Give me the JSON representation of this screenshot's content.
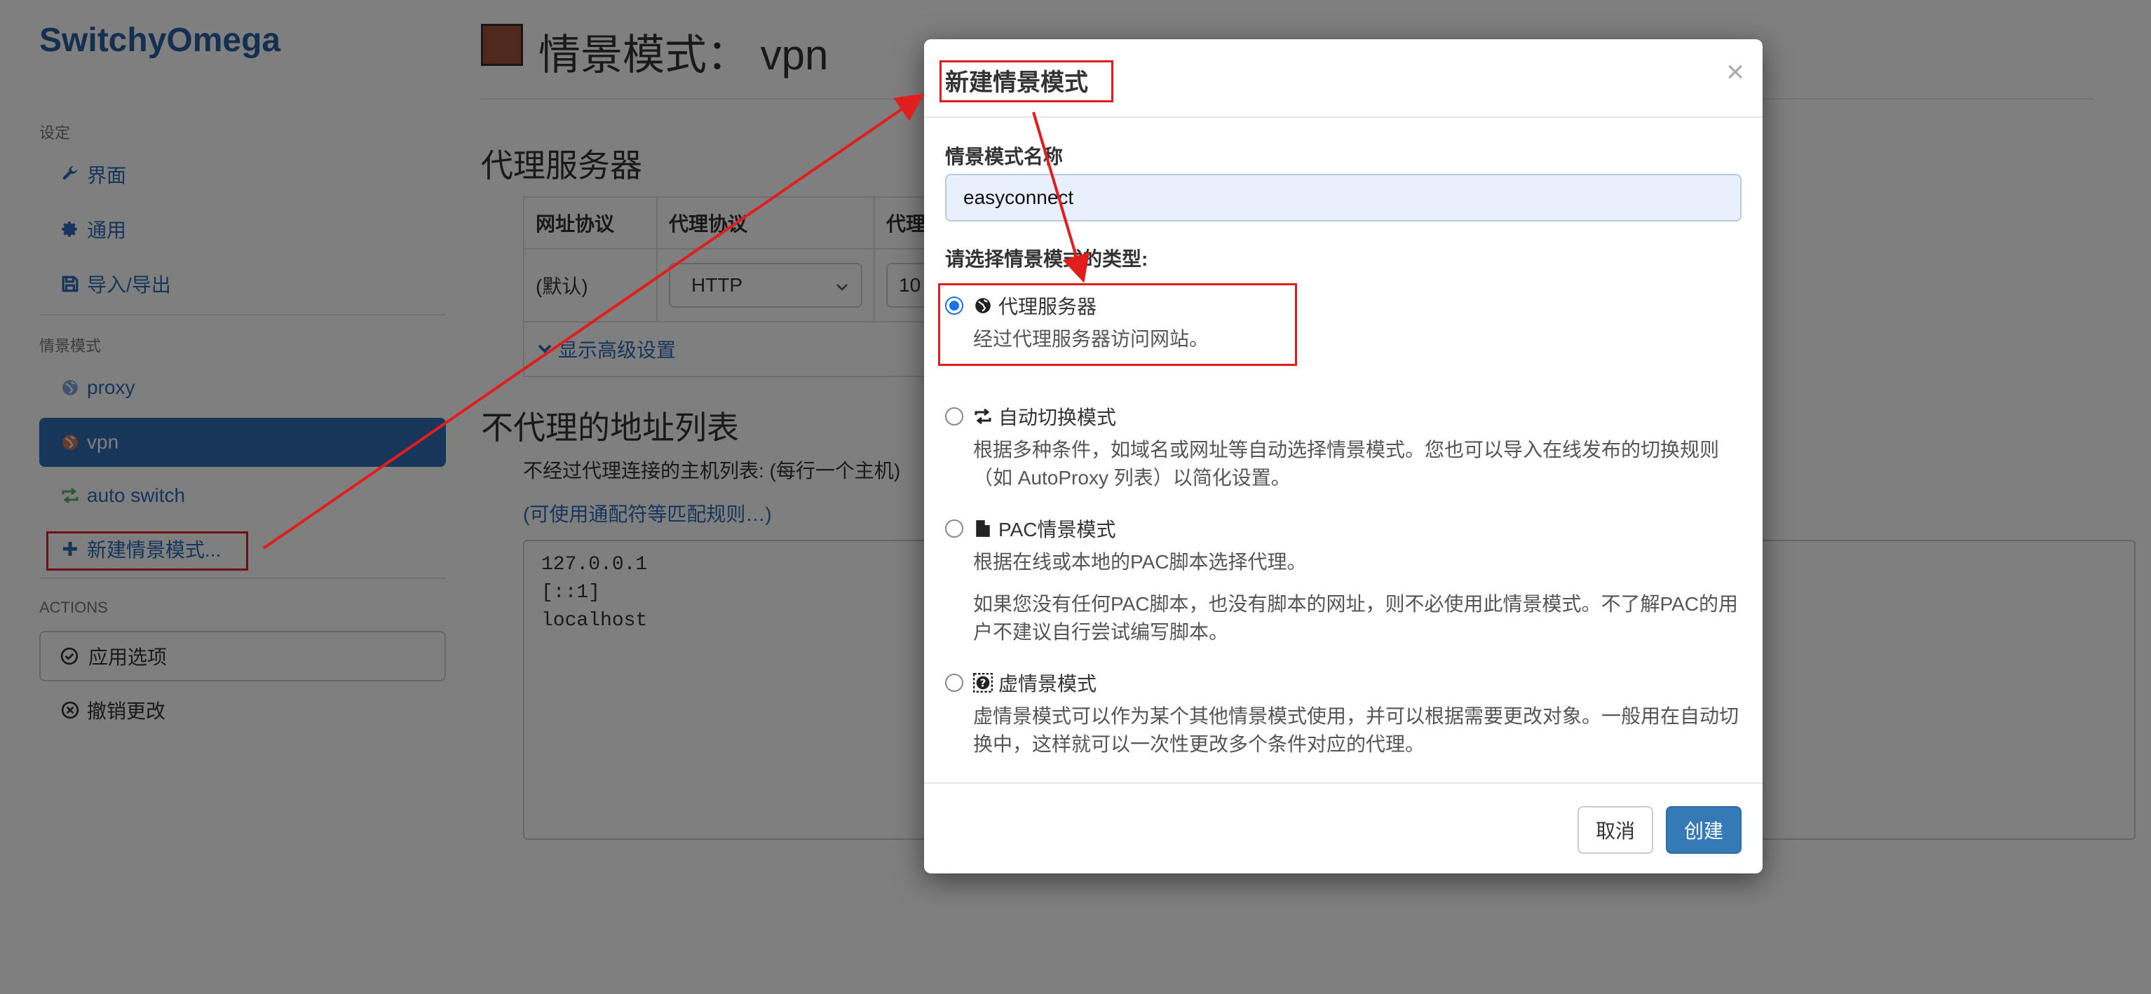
{
  "app": {
    "brand": "SwitchyOmega"
  },
  "sidebar": {
    "settings_heading": "设定",
    "settings_items": [
      {
        "icon": "wrench-icon",
        "label": "界面"
      },
      {
        "icon": "gear-icon",
        "label": "通用"
      },
      {
        "icon": "import-export-icon",
        "label": "导入/导出"
      }
    ],
    "profiles_heading": "情景模式",
    "profile_items": [
      {
        "icon": "globe-icon",
        "label": "proxy",
        "active": false
      },
      {
        "icon": "globe-icon",
        "label": "vpn",
        "active": true
      },
      {
        "icon": "switch-icon",
        "label": "auto switch",
        "active": false
      }
    ],
    "new_profile": "新建情景模式...",
    "actions_heading": "ACTIONS",
    "apply": "应用选项",
    "discard": "撤销更改"
  },
  "main": {
    "profile_title": "情景模式：  vpn",
    "profile_color": "#a0523d",
    "proxy_section": "代理服务器",
    "table_headers": [
      "网址协议",
      "代理协议",
      "代理"
    ],
    "table_row": {
      "scheme": "(默认)",
      "protocol": "HTTP",
      "server": "10"
    },
    "advanced": "显示高级设置",
    "bypass_section": "不代理的地址列表",
    "bypass_desc": "不经过代理连接的主机列表: (每行一个主机)",
    "wildcard_link": "(可使用通配符等匹配规则…)",
    "bypass_list": "127.0.0.1\n[::1]\nlocalhost"
  },
  "modal": {
    "title": "新建情景模式",
    "close": "×",
    "name_label": "情景模式名称",
    "name_value": "easyconnect",
    "type_label": "请选择情景模式的类型:",
    "options": [
      {
        "icon": "globe-icon",
        "label": "代理服务器",
        "checked": true,
        "help": [
          "经过代理服务器访问网站。"
        ]
      },
      {
        "icon": "switch-icon",
        "label": "自动切换模式",
        "checked": false,
        "help": [
          "根据多种条件，如域名或网址等自动选择情景模式。您也可以导入在线发布的切换规则",
          "（如 AutoProxy 列表）以简化设置。"
        ]
      },
      {
        "icon": "file-icon",
        "label": "PAC情景模式",
        "checked": false,
        "help": [
          "根据在线或本地的PAC脚本选择代理。",
          "如果您没有任何PAC脚本，也没有脚本的网址，则不必使用此情景模式。不了解PAC的用",
          "户不建议自行尝试编写脚本。"
        ]
      },
      {
        "icon": "question-icon",
        "label": "虚情景模式",
        "checked": false,
        "help": [
          "虚情景模式可以作为某个其他情景模式使用，并可以根据需要更改对象。一般用在自动切",
          "换中，这样就可以一次性更改多个条件对应的代理。"
        ]
      }
    ],
    "cancel": "取消",
    "create": "创建"
  },
  "annotation_color": "#e01e1e"
}
